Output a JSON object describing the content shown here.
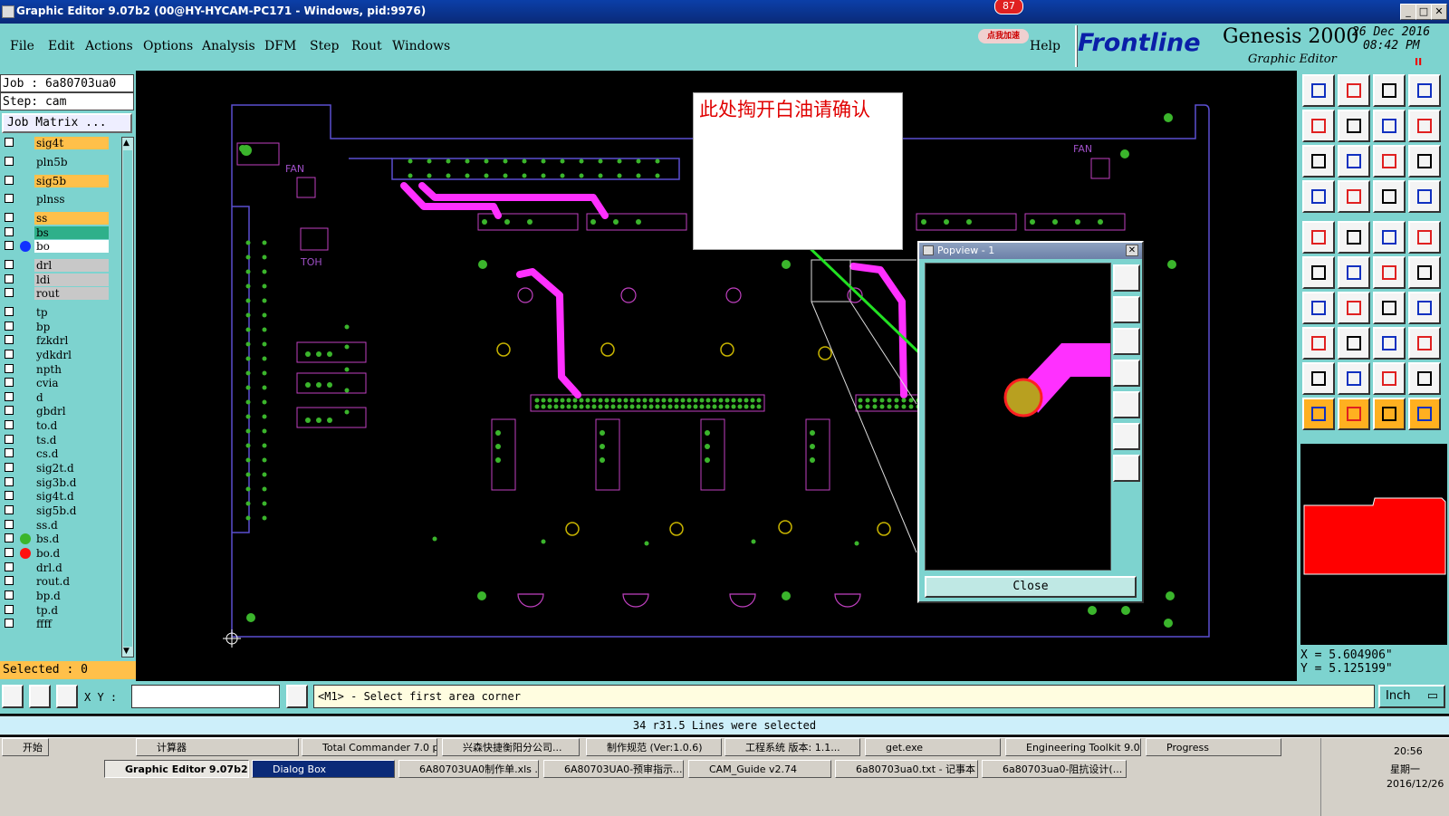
{
  "window": {
    "title": "Graphic Editor 9.07b2 (00@HY-HYCAM-PC171 - Windows, pid:9976)",
    "badge": "87",
    "badge_label": "点我加速"
  },
  "menu": [
    "File",
    "Edit",
    "Actions",
    "Options",
    "Analysis",
    "DFM",
    "Step",
    "Rout",
    "Windows"
  ],
  "help": "Help",
  "brand": {
    "logo": "Frontline",
    "product": "Genesis 2000",
    "subtitle": "Graphic Editor",
    "date": "26 Dec 2016",
    "time": "08:42 PM",
    "pause": "II"
  },
  "job": {
    "job_line": "Job : 6a80703ua0",
    "step_line": "Step: cam",
    "matrix_button": "Job Matrix ..."
  },
  "layers": [
    {
      "name": "sig4t",
      "color": "#ffc04a"
    },
    {
      "name": "pln5b",
      "color": "#7dd3cf"
    },
    {
      "name": "sig5b",
      "color": "#ffc04a"
    },
    {
      "name": "plnss",
      "color": "#7dd3cf"
    },
    {
      "name": "ss",
      "color": "#ffc04a"
    },
    {
      "name": "bs",
      "color": "#2fb08a"
    },
    {
      "name": "bo",
      "color": "#ffffff"
    },
    {
      "name": "drl",
      "color": "#c8c8c8"
    },
    {
      "name": "ldi",
      "color": "#c8c8c8"
    },
    {
      "name": "rout",
      "color": "#c8c8c8"
    },
    {
      "name": "tp",
      "color": "#7dd3cf"
    },
    {
      "name": "bp",
      "color": "#7dd3cf"
    },
    {
      "name": "fzkdrl",
      "color": "#7dd3cf"
    },
    {
      "name": "ydkdrl",
      "color": "#7dd3cf"
    },
    {
      "name": "npth",
      "color": "#7dd3cf"
    },
    {
      "name": "cvia",
      "color": "#7dd3cf"
    },
    {
      "name": "d",
      "color": "#7dd3cf"
    },
    {
      "name": "gbdrl",
      "color": "#7dd3cf"
    },
    {
      "name": "to.d",
      "color": "#7dd3cf"
    },
    {
      "name": "ts.d",
      "color": "#7dd3cf"
    },
    {
      "name": "cs.d",
      "color": "#7dd3cf"
    },
    {
      "name": "sig2t.d",
      "color": "#7dd3cf"
    },
    {
      "name": "sig3b.d",
      "color": "#7dd3cf"
    },
    {
      "name": "sig4t.d",
      "color": "#7dd3cf"
    },
    {
      "name": "sig5b.d",
      "color": "#7dd3cf"
    },
    {
      "name": "ss.d",
      "color": "#7dd3cf"
    },
    {
      "name": "bs.d",
      "color": "#7dd3cf"
    },
    {
      "name": "bo.d",
      "color": "#7dd3cf"
    },
    {
      "name": "drl.d",
      "color": "#7dd3cf"
    },
    {
      "name": "rout.d",
      "color": "#7dd3cf"
    },
    {
      "name": "bp.d",
      "color": "#7dd3cf"
    },
    {
      "name": "tp.d",
      "color": "#7dd3cf"
    },
    {
      "name": "ffff",
      "color": "#7dd3cf"
    }
  ],
  "selected": "Selected : 0",
  "canvas_labels": {
    "fan_left": "FAN",
    "fan_right": "FAN",
    "toh": "TOH"
  },
  "note": "此处掏开白油请确认",
  "popview": {
    "title": "Popview - 1",
    "close": "Close"
  },
  "coords": {
    "x": "X = 5.604906\"",
    "y": "Y = 5.125199\""
  },
  "command": {
    "xy_label": "X Y :",
    "xy_value": "",
    "prompt": "<M1> - Select first area corner",
    "units": "Inch"
  },
  "status": "34 r31.5 Lines were selected",
  "taskbar": {
    "start": "开始",
    "row1": [
      "计算器",
      "Total Commander 7.0 p...",
      "兴森快捷衡阳分公司...",
      "制作规范 (Ver:1.0.6)",
      "工程系统  版本: 1.1...",
      "get.exe",
      "Engineering Toolkit 9.0...",
      "Progress"
    ],
    "row2": [
      "Graphic Editor 9.07b2 ...",
      "Dialog Box",
      "6A80703UA0制作单.xls ...",
      "6A80703UA0-预审指示...",
      "CAM_Guide v2.74",
      "6a80703ua0.txt - 记事本",
      "6a80703ua0-阻抗设计(..."
    ],
    "clock": "20:56",
    "weekday": "星期一",
    "date": "2016/12/26"
  },
  "colors": {
    "panel": "#7dd3cf",
    "trace": "#ff30ff",
    "pad": "#3bb52c",
    "outline": "#5a4fd0",
    "arrow": "#22e022",
    "note_text": "#e00000",
    "minimap_board": "#ff0000"
  }
}
